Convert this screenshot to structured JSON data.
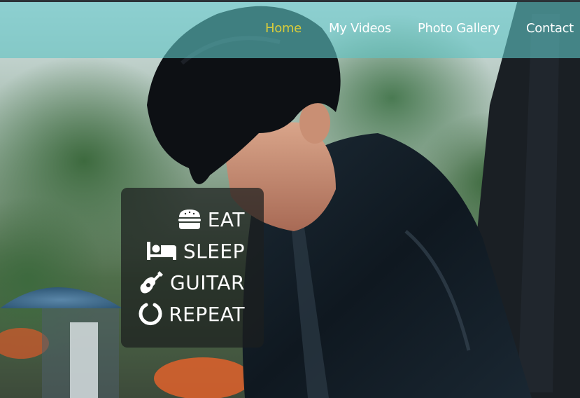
{
  "nav": {
    "items": [
      {
        "label": "Home",
        "active": true
      },
      {
        "label": "My Videos",
        "active": false
      },
      {
        "label": "Photo Gallery",
        "active": false
      },
      {
        "label": "Contact",
        "active": false
      }
    ],
    "active_color": "#d9cc3a",
    "bar_color": "#60c4c4"
  },
  "motto": {
    "lines": [
      {
        "icon": "burger-icon",
        "text": "EAT"
      },
      {
        "icon": "bed-icon",
        "text": "SLEEP"
      },
      {
        "icon": "guitar-icon",
        "text": "GUITAR"
      },
      {
        "icon": "repeat-icon",
        "text": "REPEAT"
      }
    ]
  }
}
